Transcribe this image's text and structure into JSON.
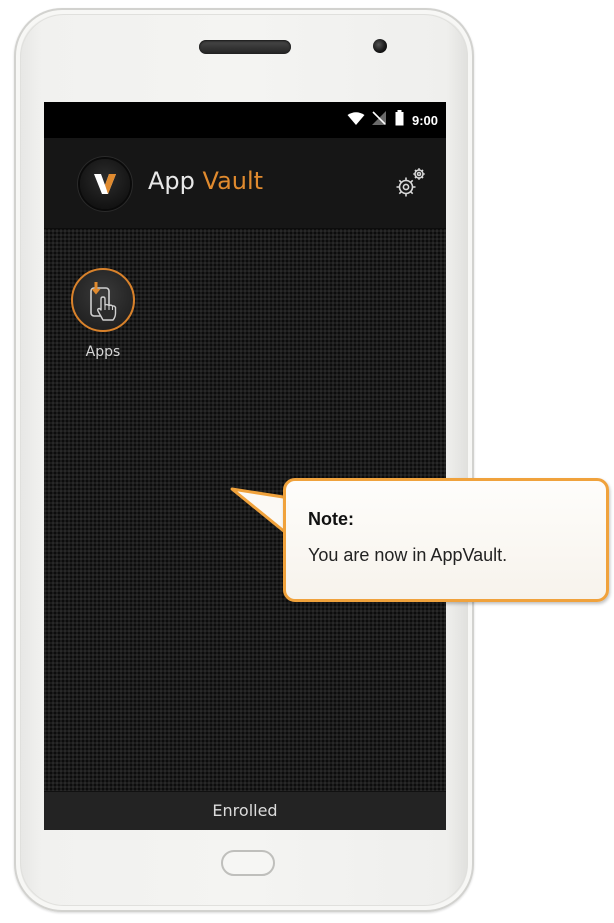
{
  "status_bar": {
    "time": "9:00",
    "icons": [
      "wifi-icon",
      "no-signal-icon",
      "battery-icon"
    ]
  },
  "header": {
    "title_part1": "App",
    "title_part2": "Vault",
    "logo_icon": "appvault-logo-icon",
    "settings_icon": "settings-gear-icon"
  },
  "apps": [
    {
      "label": "Apps",
      "icon": "app-download-tap-icon"
    }
  ],
  "footer": {
    "status": "Enrolled"
  },
  "callout": {
    "title": "Note:",
    "body": "You are now in AppVault."
  },
  "colors": {
    "accent": "#e08a2e",
    "callout_border": "#f0a23c",
    "screen_background": "#1b1b1b"
  }
}
